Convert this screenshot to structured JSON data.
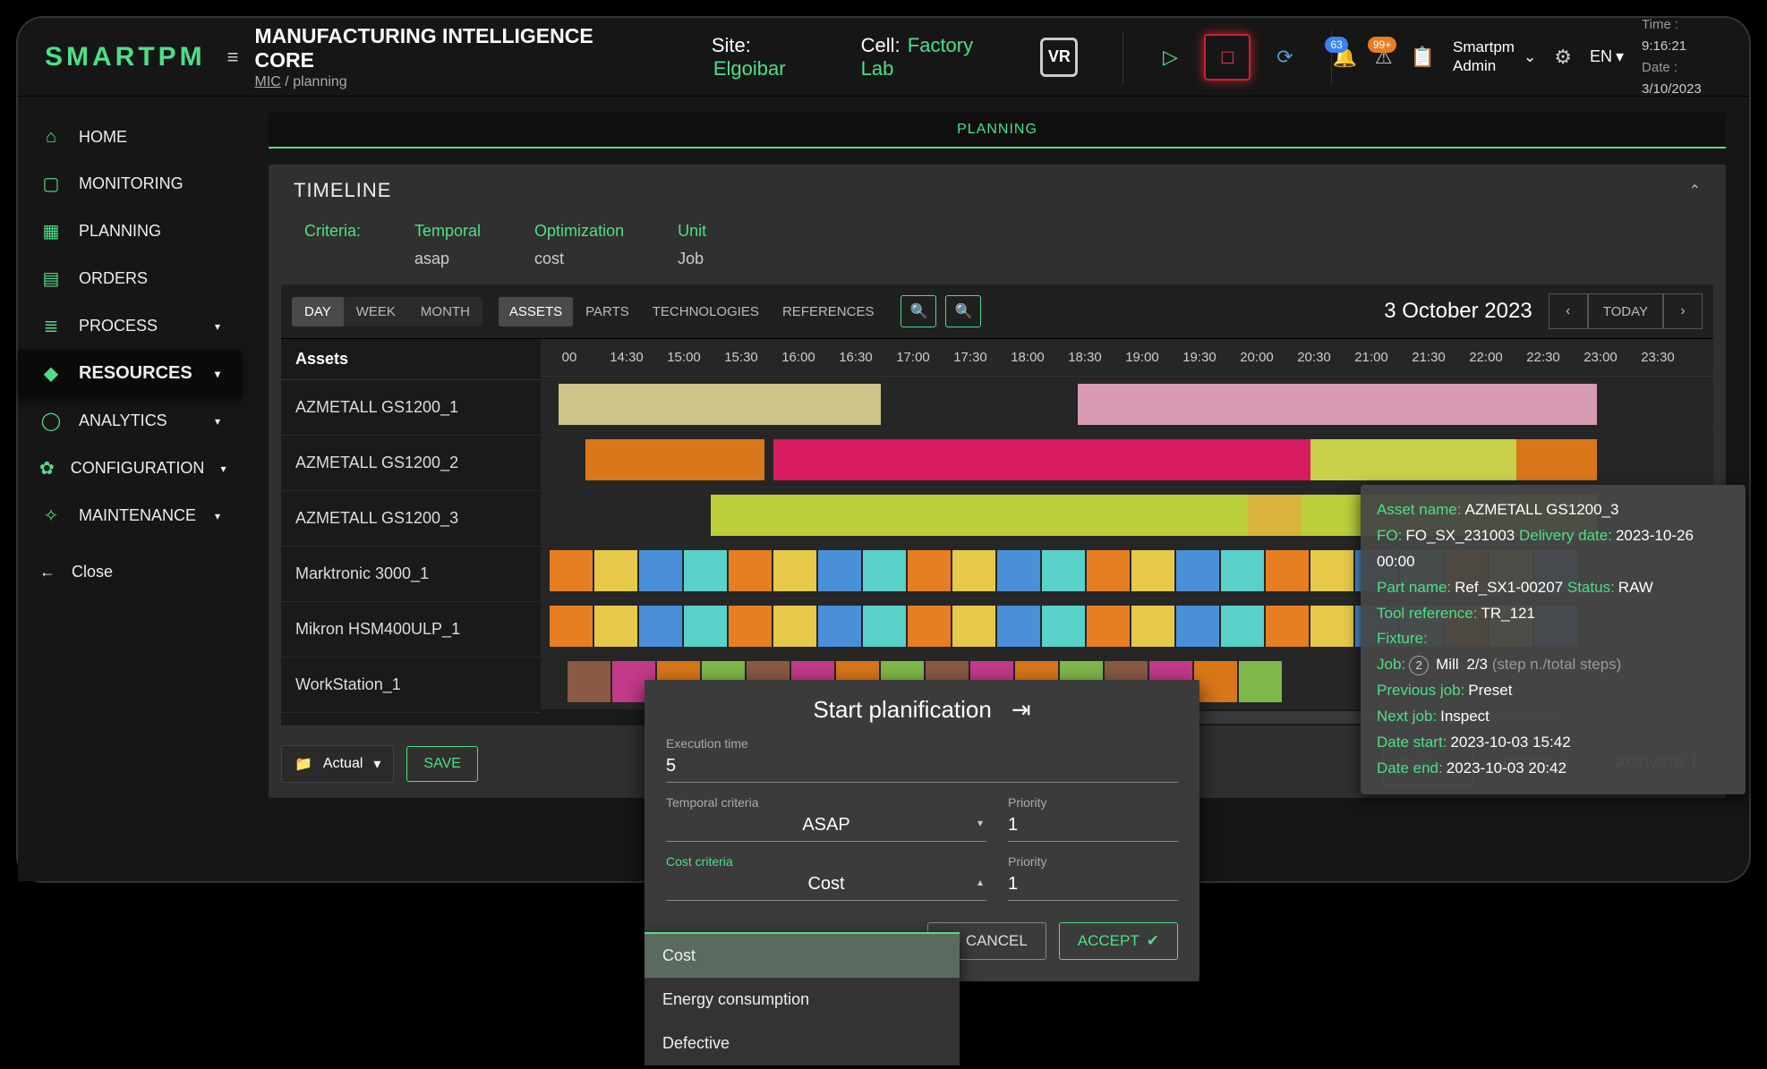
{
  "brand": "SMARTPM",
  "header": {
    "title": "MANUFACTURING INTELLIGENCE CORE",
    "breadcrumb_root": "MIC",
    "breadcrumb_sep": "/",
    "breadcrumb_page": "planning",
    "site_label": "Site:",
    "site_value": "Elgoibar",
    "cell_label": "Cell:",
    "cell_value": "Factory Lab",
    "vr": "VR",
    "badge_bell": "63",
    "badge_warn": "99+",
    "user_line1": "Smartpm",
    "user_line2": "Admin",
    "lang": "EN",
    "time_label": "Time :",
    "time_value": "9:16:21",
    "date_label": "Date :",
    "date_value": "3/10/2023"
  },
  "sidebar": {
    "items": [
      {
        "label": "HOME",
        "icon": "⌂"
      },
      {
        "label": "MONITORING",
        "icon": "▢"
      },
      {
        "label": "PLANNING",
        "icon": "▦"
      },
      {
        "label": "ORDERS",
        "icon": "▤"
      },
      {
        "label": "PROCESS",
        "icon": "≣",
        "chev": true
      },
      {
        "label": "RESOURCES",
        "icon": "◆",
        "chev": true,
        "active": true
      },
      {
        "label": "ANALYTICS",
        "icon": "◯",
        "chev": true
      },
      {
        "label": "CONFIGURATION",
        "icon": "✿",
        "chev": true
      },
      {
        "label": "MAINTENANCE",
        "icon": "✧",
        "chev": true
      }
    ],
    "close": "Close"
  },
  "page_tab": "PLANNING",
  "panel_title": "TIMELINE",
  "criteria": {
    "label": "Criteria:",
    "cols": [
      {
        "k": "Temporal",
        "v": "asap"
      },
      {
        "k": "Optimization",
        "v": "cost"
      },
      {
        "k": "Unit",
        "v": "Job"
      }
    ]
  },
  "range": {
    "day": "DAY",
    "week": "WEEK",
    "month": "MONTH"
  },
  "resource_tabs": [
    "ASSETS",
    "PARTS",
    "TECHNOLOGIES",
    "REFERENCES"
  ],
  "date_display": "3 October 2023",
  "today": "TODAY",
  "gantt": {
    "header": "Assets",
    "times": [
      "00",
      "14:30",
      "15:00",
      "15:30",
      "16:00",
      "16:30",
      "17:00",
      "17:30",
      "18:00",
      "18:30",
      "19:00",
      "19:30",
      "20:00",
      "20:30",
      "21:00",
      "21:30",
      "22:00",
      "22:30",
      "23:00",
      "23:30"
    ],
    "rows": [
      {
        "name": "AZMETALL GS1200_1"
      },
      {
        "name": "AZMETALL GS1200_2"
      },
      {
        "name": "AZMETALL GS1200_3"
      },
      {
        "name": "Marktronic 3000_1"
      },
      {
        "name": "Mikron HSM400ULP_1"
      },
      {
        "name": "WorkStation_1"
      }
    ]
  },
  "footer": {
    "actual": "Actual",
    "save": "SAVE",
    "plan": "PLAN",
    "reset": "RESET",
    "activate": "ACTIVATE"
  },
  "modal": {
    "title": "Start planification",
    "exec_label": "Execution time",
    "exec_value": "5",
    "temporal_label": "Temporal criteria",
    "temporal_value": "ASAP",
    "priority_label": "Priority",
    "priority_value": "1",
    "cost_label": "Cost criteria",
    "cost_value": "Cost",
    "priority2_value": "1",
    "cancel": "CANCEL",
    "accept": "ACCEPT"
  },
  "dropdown": {
    "items": [
      "Cost",
      "Energy consumption",
      "Defective"
    ]
  },
  "tooltip": {
    "asset_k": "Asset name:",
    "asset_v": "AZMETALL GS1200_3",
    "fo_k": "FO:",
    "fo_v": "FO_SX_231003",
    "deliv_k": "Delivery date:",
    "deliv_v": "2023-10-26 00:00",
    "part_k": "Part name:",
    "part_v": "Ref_SX1-00207",
    "status_k": "Status:",
    "status_v": "RAW",
    "tool_k": "Tool reference:",
    "tool_v": "TR_121",
    "fixture_k": "Fixture:",
    "job_k": "Job:",
    "job_step": "2",
    "job_name": "Mill",
    "job_progress": "2/3",
    "job_note": "(step n./total steps)",
    "prev_k": "Previous job:",
    "prev_v": "Preset",
    "next_k": "Next job:",
    "next_v": "Inspect",
    "start_k": "Date start:",
    "start_v": "2023-10-03 15:42",
    "end_k": "Date end:",
    "end_v": "2023-10-03 20:42"
  }
}
